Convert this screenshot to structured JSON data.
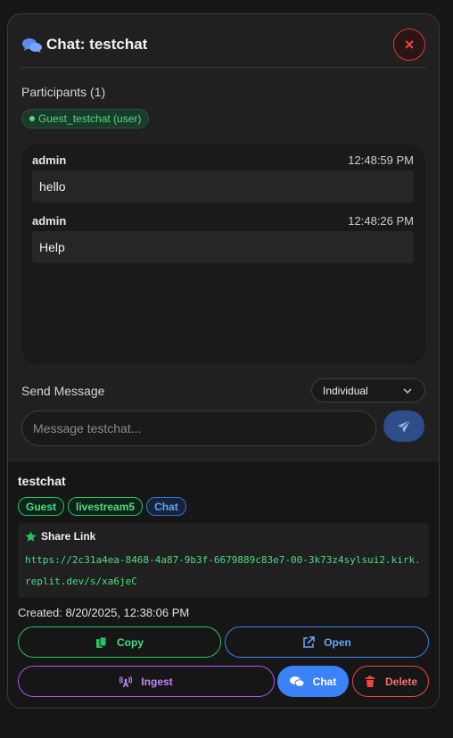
{
  "dialog": {
    "title": "Chat: testchat",
    "close_label": "×"
  },
  "participants": {
    "heading": "Participants (1)",
    "items": [
      {
        "label": "Guest_testchat (user)"
      }
    ]
  },
  "messages": [
    {
      "sender": "admin",
      "time": "12:48:59 PM",
      "text": "hello"
    },
    {
      "sender": "admin",
      "time": "12:48:26 PM",
      "text": "Help"
    }
  ],
  "composer": {
    "label": "Send Message",
    "mode_selected": "Individual",
    "input_value": "",
    "placeholder": "Message testchat..."
  },
  "session": {
    "name": "testchat",
    "tags": [
      {
        "label": "Guest",
        "color": "green"
      },
      {
        "label": "livestream5",
        "color": "green"
      },
      {
        "label": "Chat",
        "color": "blue"
      }
    ],
    "share_heading": "Share Link",
    "share_url": "https://2c31a4ea-8468-4a87-9b3f-6679889c83e7-00-3k73z4sylsui2.kirk.replit.dev/s/xa6jeC",
    "created": "Created: 8/20/2025, 12:38:06 PM"
  },
  "actions": {
    "copy": "Copy",
    "open": "Open",
    "ingest": "Ingest",
    "chat": "Chat",
    "delete": "Delete"
  },
  "colors": {
    "accent_blue": "#3b82f6",
    "success_green": "#22c55e",
    "danger_red": "#ef4444",
    "purple": "#a855f7"
  },
  "icons": [
    "comments-icon",
    "close-icon",
    "chevron-down-icon",
    "paper-plane-icon",
    "star-icon",
    "copy-icon",
    "external-link-icon",
    "broadcast-icon",
    "chat-icon",
    "trash-icon"
  ]
}
